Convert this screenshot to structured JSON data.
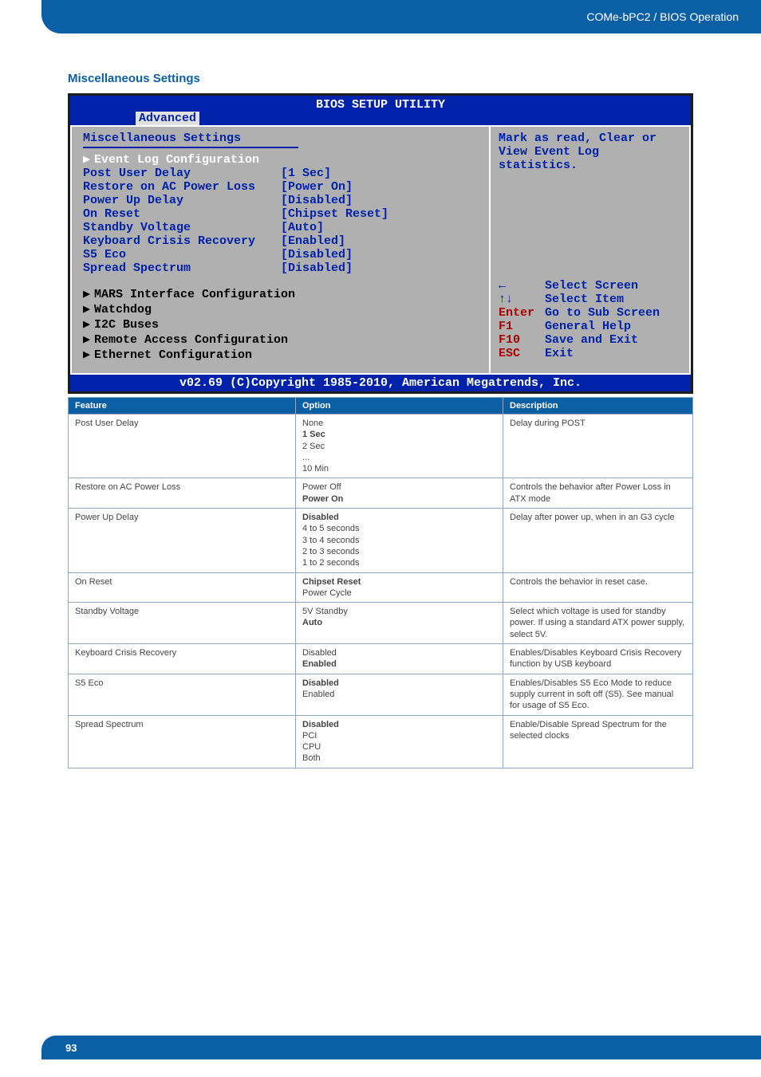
{
  "header": {
    "breadcrumb": "COMe-bPC2 / BIOS Operation"
  },
  "section_title": "Miscellaneous Settings",
  "bios": {
    "title": "BIOS SETUP UTILITY",
    "tab": "Advanced",
    "panel_title": "Miscellaneous Settings",
    "selected_submenu": "Event Log Configuration",
    "settings": [
      {
        "k": "Post User Delay",
        "v": "[1 Sec]"
      },
      {
        "k": "Restore on AC Power Loss",
        "v": "[Power On]"
      },
      {
        "k": "Power Up Delay",
        "v": "[Disabled]"
      },
      {
        "k": "On Reset",
        "v": "[Chipset Reset]"
      },
      {
        "k": "Standby Voltage",
        "v": "[Auto]"
      },
      {
        "k": "Keyboard Crisis Recovery",
        "v": "[Enabled]"
      },
      {
        "k": "S5 Eco",
        "v": "[Disabled]"
      },
      {
        "k": "Spread Spectrum",
        "v": "[Disabled]"
      }
    ],
    "submenus": [
      "MARS Interface Configuration",
      "Watchdog",
      "I2C Buses",
      "Remote Access Configuration",
      "Ethernet Configuration"
    ],
    "help": "Mark as read, Clear or View Event Log statistics.",
    "nav": [
      {
        "key": "←",
        "label": "Select Screen"
      },
      {
        "key": "↑↓",
        "label": "Select Item"
      },
      {
        "key": "Enter",
        "label": "Go to Sub Screen"
      },
      {
        "key": "F1",
        "label": "General Help"
      },
      {
        "key": "F10",
        "label": "Save and Exit"
      },
      {
        "key": "ESC",
        "label": "Exit"
      }
    ],
    "copyright": "v02.69 (C)Copyright 1985-2010, American Megatrends, Inc."
  },
  "table": {
    "headers": {
      "feature": "Feature",
      "option": "Option",
      "description": "Description"
    },
    "rows": [
      {
        "feature": "Post User Delay",
        "options": [
          {
            "text": "None",
            "bold": false
          },
          {
            "text": "1 Sec",
            "bold": true
          },
          {
            "text": "2 Sec",
            "bold": false
          },
          {
            "text": "...",
            "bold": false
          },
          {
            "text": "10 Min",
            "bold": false
          }
        ],
        "description": "Delay during POST"
      },
      {
        "feature": "Restore on AC Power Loss",
        "options": [
          {
            "text": "Power Off",
            "bold": false
          },
          {
            "text": "Power On",
            "bold": true
          }
        ],
        "description": "Controls the behavior after Power Loss in ATX mode"
      },
      {
        "feature": "Power Up Delay",
        "options": [
          {
            "text": "Disabled",
            "bold": true
          },
          {
            "text": "4 to 5 seconds",
            "bold": false
          },
          {
            "text": "3 to 4 seconds",
            "bold": false
          },
          {
            "text": "2 to 3 seconds",
            "bold": false
          },
          {
            "text": "1 to 2 seconds",
            "bold": false
          }
        ],
        "description": "Delay after power up, when in an G3 cycle"
      },
      {
        "feature": "On Reset",
        "options": [
          {
            "text": "Chipset Reset",
            "bold": true
          },
          {
            "text": "Power Cycle",
            "bold": false
          }
        ],
        "description": "Controls the behavior in reset case."
      },
      {
        "feature": "Standby Voltage",
        "options": [
          {
            "text": "5V Standby",
            "bold": false
          },
          {
            "text": "Auto",
            "bold": true
          }
        ],
        "description": "Select which voltage is used for standby power. If using a standard ATX power supply, select 5V."
      },
      {
        "feature": "Keyboard Crisis Recovery",
        "options": [
          {
            "text": "Disabled",
            "bold": false
          },
          {
            "text": "Enabled",
            "bold": true
          }
        ],
        "description": "Enables/Disables Keyboard Crisis Recovery function by USB keyboard"
      },
      {
        "feature": "S5 Eco",
        "options": [
          {
            "text": "Disabled",
            "bold": true
          },
          {
            "text": "Enabled",
            "bold": false
          }
        ],
        "description": "Enables/Disables S5 Eco Mode to reduce supply current in soft off (S5). See manual for usage of S5 Eco."
      },
      {
        "feature": "Spread Spectrum",
        "options": [
          {
            "text": "Disabled",
            "bold": true
          },
          {
            "text": "PCI",
            "bold": false
          },
          {
            "text": "CPU",
            "bold": false
          },
          {
            "text": "Both",
            "bold": false
          }
        ],
        "description": "Enable/Disable Spread Spectrum for the selected clocks"
      }
    ]
  },
  "page_number": "93"
}
